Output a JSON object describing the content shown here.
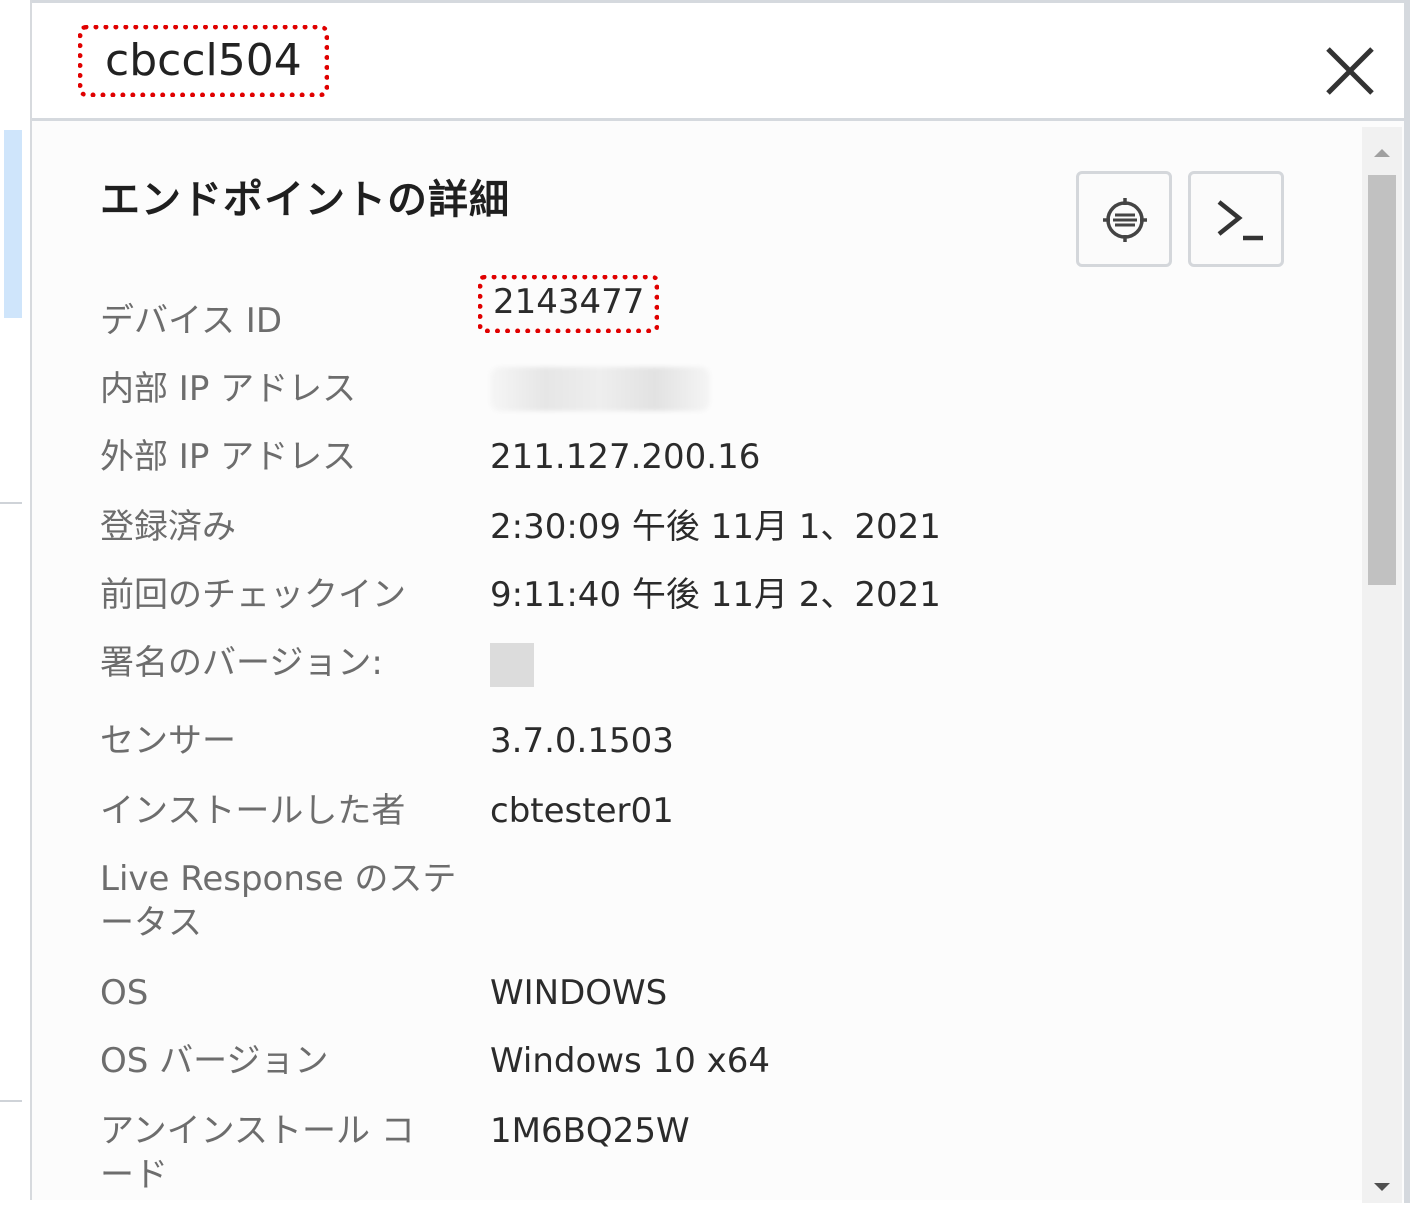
{
  "panel": {
    "endpoint_name": "cbccl504",
    "title": "エンドポイントの詳細",
    "close_icon": "close-icon",
    "actions": [
      {
        "name": "quarantine-button",
        "icon": "target-icon"
      },
      {
        "name": "live-response-button",
        "icon": "terminal-icon"
      }
    ]
  },
  "details": {
    "device_id": {
      "label": "デバイス ID",
      "value": "2143477"
    },
    "internal_ip": {
      "label": "内部 IP アドレス"
    },
    "external_ip": {
      "label": "外部 IP アドレス",
      "value": "211.127.200.16"
    },
    "registered": {
      "label": "登録済み",
      "value": "2:30:09 午後 11月 1、2021"
    },
    "last_checkin": {
      "label": "前回のチェックイン",
      "value": "9:11:40 午後 11月 2、2021"
    },
    "signature_version": {
      "label": "署名のバージョン:"
    },
    "sensor": {
      "label": "センサー",
      "value": "3.7.0.1503"
    },
    "installed_by": {
      "label": "インストールした者",
      "value": "cbtester01"
    },
    "live_response_status": {
      "label_line1": "Live Response のステ",
      "label_line2": "ータス"
    },
    "os": {
      "label": "OS",
      "value": "WINDOWS"
    },
    "os_version": {
      "label": "OS バージョン",
      "value": "Windows 10 x64"
    },
    "uninstall_code": {
      "label_line1": "アンインストール コ",
      "label_line2": "ード",
      "value": "1M6BQ25W"
    }
  },
  "colors": {
    "highlight": "#e00000",
    "label": "#6d6d6d",
    "value": "#2b2b2b"
  }
}
